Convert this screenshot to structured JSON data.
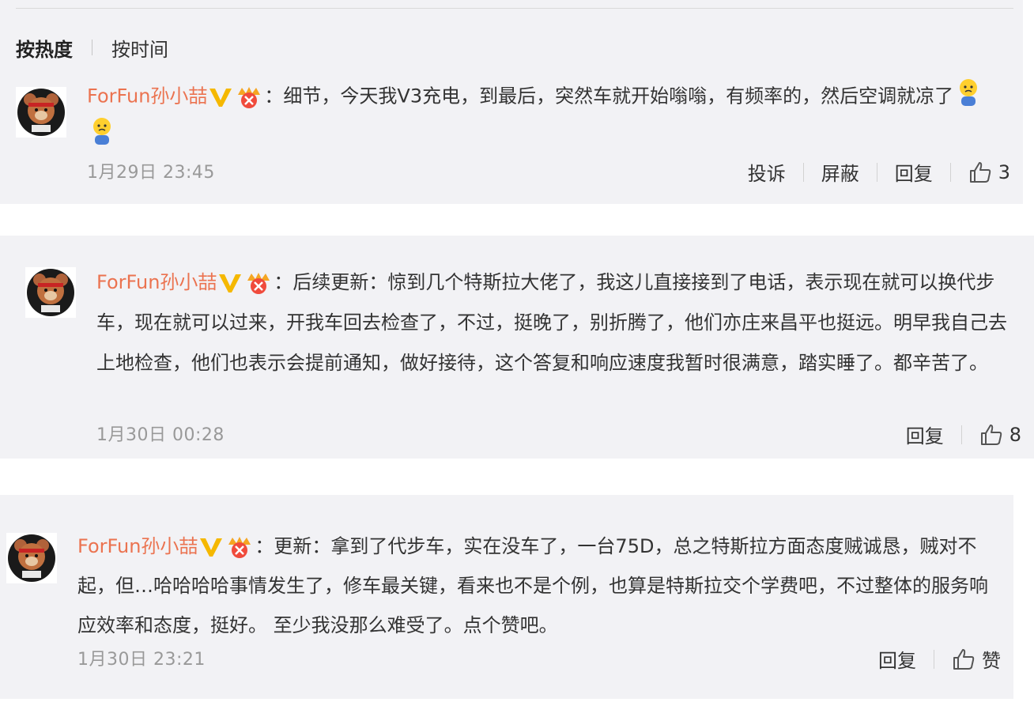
{
  "sort_tabs": {
    "hot": "按热度",
    "time": "按时间"
  },
  "comments": [
    {
      "username": "ForFun孙小喆",
      "text": "：细节，今天我V3充电，到最后，突然车就开始嗡嗡，有频率的，然后空调就凉了",
      "timestamp": "1月29日 23:45",
      "actions": {
        "report": "投诉",
        "block": "屏蔽",
        "reply": "回复"
      },
      "likes": "3"
    },
    {
      "username": "ForFun孙小喆",
      "text": "：后续更新：惊到几个特斯拉大佬了，我这儿直接接到了电话，表示现在就可以换代步车，现在就可以过来，开我车回去检查了，不过，挺晚了，别折腾了，他们亦庄来昌平也挺远。明早我自己去上地检查，他们也表示会提前通知，做好接待，这个答复和响应速度我暂时很满意，踏实睡了。都辛苦了。",
      "timestamp": "1月30日 00:28",
      "actions": {
        "reply": "回复"
      },
      "likes": "8"
    },
    {
      "username": "ForFun孙小喆",
      "text": "：更新：拿到了代步车，实在没车了，一台75D，总之特斯拉方面态度贼诚恳，贼对不起，但…哈哈哈哈事情发生了，修车最关键，看来也不是个例，也算是特斯拉交个学费吧，不过整体的服务响应效率和态度，挺好。 至少我没那么难受了。点个赞吧。",
      "timestamp": "1月30日 23:21",
      "actions": {
        "reply": "回复"
      },
      "likes": "赞"
    }
  ],
  "icons": {
    "verified": "verified-v-icon",
    "member": "member-crown-icon",
    "like": "thumbs-up-icon",
    "emoji": "waiting-emoji-icon"
  },
  "colors": {
    "username": "#eb7350",
    "verified": "#f5b800",
    "member": "#f04b3c",
    "timestamp": "#999999",
    "panel": "#f2f2f5"
  }
}
